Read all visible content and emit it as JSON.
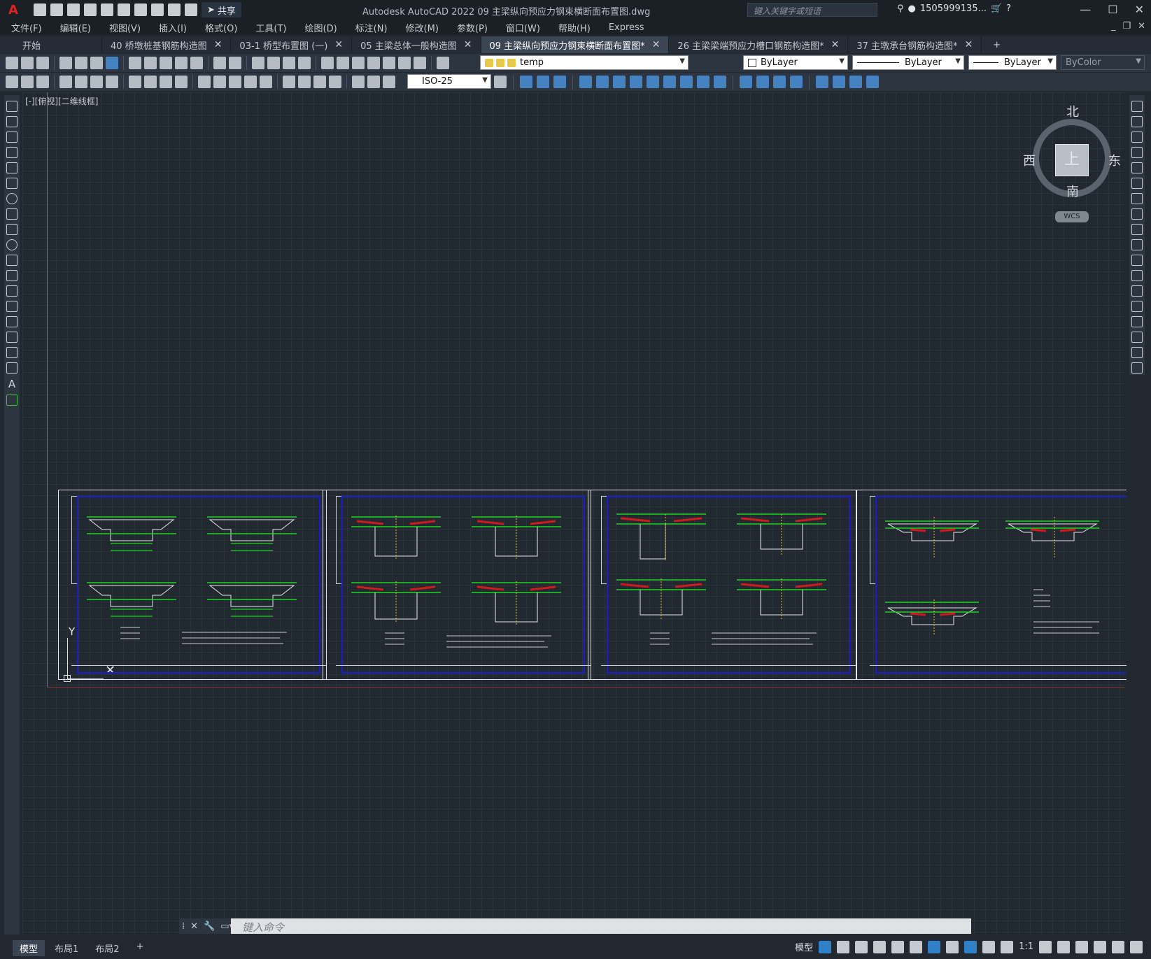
{
  "app": {
    "title": "Autodesk AutoCAD 2022    09 主梁纵向预应力钢束横断面布置图.dwg",
    "logo": "A",
    "share_label": "共享",
    "search_placeholder": "键入关键字或短语",
    "user": "1505999135...",
    "window_controls": [
      "—",
      "☐",
      "✕"
    ]
  },
  "menus": [
    "文件(F)",
    "编辑(E)",
    "视图(V)",
    "插入(I)",
    "格式(O)",
    "工具(T)",
    "绘图(D)",
    "标注(N)",
    "修改(M)",
    "参数(P)",
    "窗口(W)",
    "帮助(H)",
    "Express"
  ],
  "doc_window_controls": [
    "_",
    "❐",
    "✕"
  ],
  "tabs": [
    {
      "label": "开始",
      "active": false,
      "closable": false
    },
    {
      "label": "40 桥墩桩基钢筋构造图",
      "active": false,
      "closable": true
    },
    {
      "label": "03-1 桥型布置图 (一)",
      "active": false,
      "closable": true
    },
    {
      "label": "05 主梁总体一般构造图",
      "active": false,
      "closable": true
    },
    {
      "label": "09 主梁纵向预应力钢束横断面布置图*",
      "active": true,
      "closable": true
    },
    {
      "label": "26 主梁梁端预应力槽口钢筋构造图*",
      "active": false,
      "closable": true
    },
    {
      "label": "37 主墩承台钢筋构造图*",
      "active": false,
      "closable": true
    }
  ],
  "toolbar": {
    "layer": "temp",
    "color": "ByLayer",
    "linetype": "ByLayer",
    "lineweight": "ByLayer",
    "plotstyle": "ByColor",
    "dimstyle": "ISO-25"
  },
  "viewport": {
    "label": "[-][俯视][二维线框]"
  },
  "viewcube": {
    "top": "上",
    "north": "北",
    "south": "南",
    "east": "东",
    "west": "西",
    "wcs": "WCS"
  },
  "ucs": {
    "x": "X",
    "y": "Y"
  },
  "command": {
    "placeholder": "键入命令"
  },
  "status": {
    "layout_tabs": [
      "模型",
      "布局1",
      "布局2"
    ],
    "model_label": "模型",
    "scale": "1:1"
  },
  "colors": {
    "background": "#212830",
    "sheet_border": "#1c1ccf",
    "green_rebar": "#1ed41e",
    "red_tendon": "#d11a1a"
  }
}
